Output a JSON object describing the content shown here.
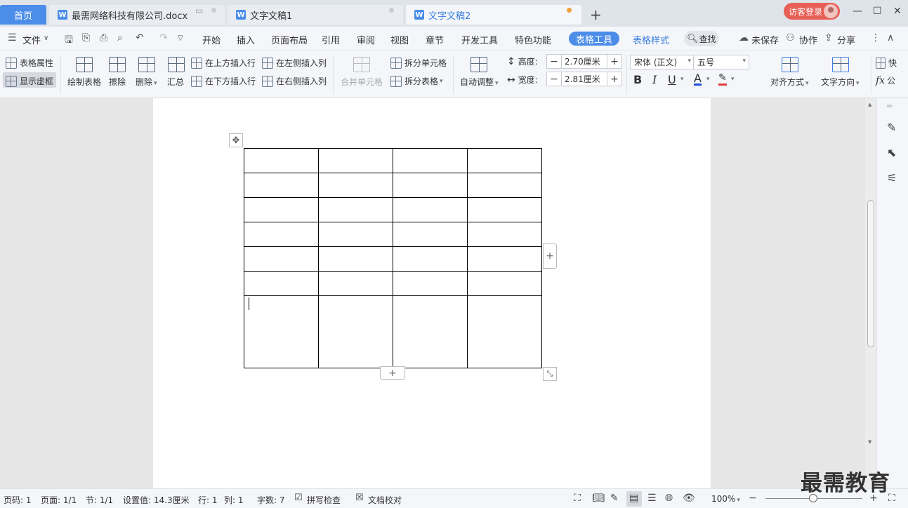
{
  "tabs": {
    "home": "首页",
    "doc1": "最需网络科技有限公司.docx",
    "doc2": "文字文稿1",
    "doc3": "文字文稿2",
    "new_tab": "+",
    "login": "访客登录"
  },
  "menu": {
    "file": "文件",
    "items": [
      "开始",
      "插入",
      "页面布局",
      "引用",
      "审阅",
      "视图",
      "章节",
      "开发工具",
      "特色功能"
    ],
    "table_tools": "表格工具",
    "table_style": "表格样式",
    "search": "查找",
    "unsaved": "未保存",
    "collab": "协作",
    "share": "分享"
  },
  "ribbon": {
    "table_props": "表格属性",
    "show_gridlines": "显示虚框",
    "draw_table": "绘制表格",
    "erase": "擦除",
    "delete": "删除",
    "summary": "汇总",
    "insert_above": "在上方插入行",
    "insert_below": "在下方插入行",
    "insert_left": "在左侧插入列",
    "insert_right": "在右侧插入列",
    "merge_cells": "合并单元格",
    "split_cells": "拆分单元格",
    "split_table": "拆分表格",
    "auto_fit": "自动调整",
    "height_label": "高度:",
    "height_value": "2.70厘米",
    "width_label": "宽度:",
    "width_value": "2.81厘米",
    "font_name": "宋体 (正文)",
    "font_size": "五号",
    "align": "对齐方式",
    "text_direction": "文字方向",
    "quick": "快",
    "formula": "公"
  },
  "table": {
    "rows": 7,
    "cols": 4
  },
  "status": {
    "page_num": "页码: 1",
    "pages": "页面: 1/1",
    "section": "节: 1/1",
    "setting": "设置值: 14.3厘米",
    "row": "行: 1",
    "col": "列: 1",
    "wordcount": "字数: 7",
    "spellcheck": "拼写检查",
    "proofread": "文档校对",
    "zoom": "100%"
  },
  "watermark": "最需教育"
}
